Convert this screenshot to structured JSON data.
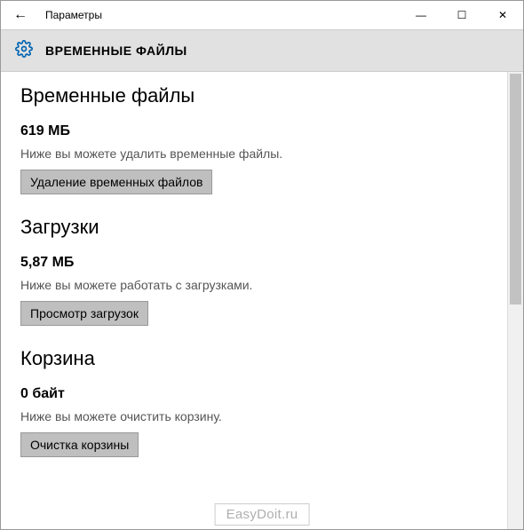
{
  "titlebar": {
    "back_glyph": "←",
    "app_title": "Параметры",
    "minimize": "—",
    "maximize": "☐",
    "close": "✕"
  },
  "header": {
    "title": "ВРЕМЕННЫЕ ФАЙЛЫ"
  },
  "sections": {
    "temp": {
      "heading": "Временные файлы",
      "size": "619 МБ",
      "desc": "Ниже вы можете удалить временные файлы.",
      "button": "Удаление временных файлов"
    },
    "downloads": {
      "heading": "Загрузки",
      "size": "5,87 МБ",
      "desc": "Ниже вы можете работать с загрузками.",
      "button": "Просмотр загрузок"
    },
    "bin": {
      "heading": "Корзина",
      "size": "0 байт",
      "desc": "Ниже вы можете очистить корзину.",
      "button": "Очистка корзины"
    }
  },
  "watermark": "EasyDoit.ru"
}
